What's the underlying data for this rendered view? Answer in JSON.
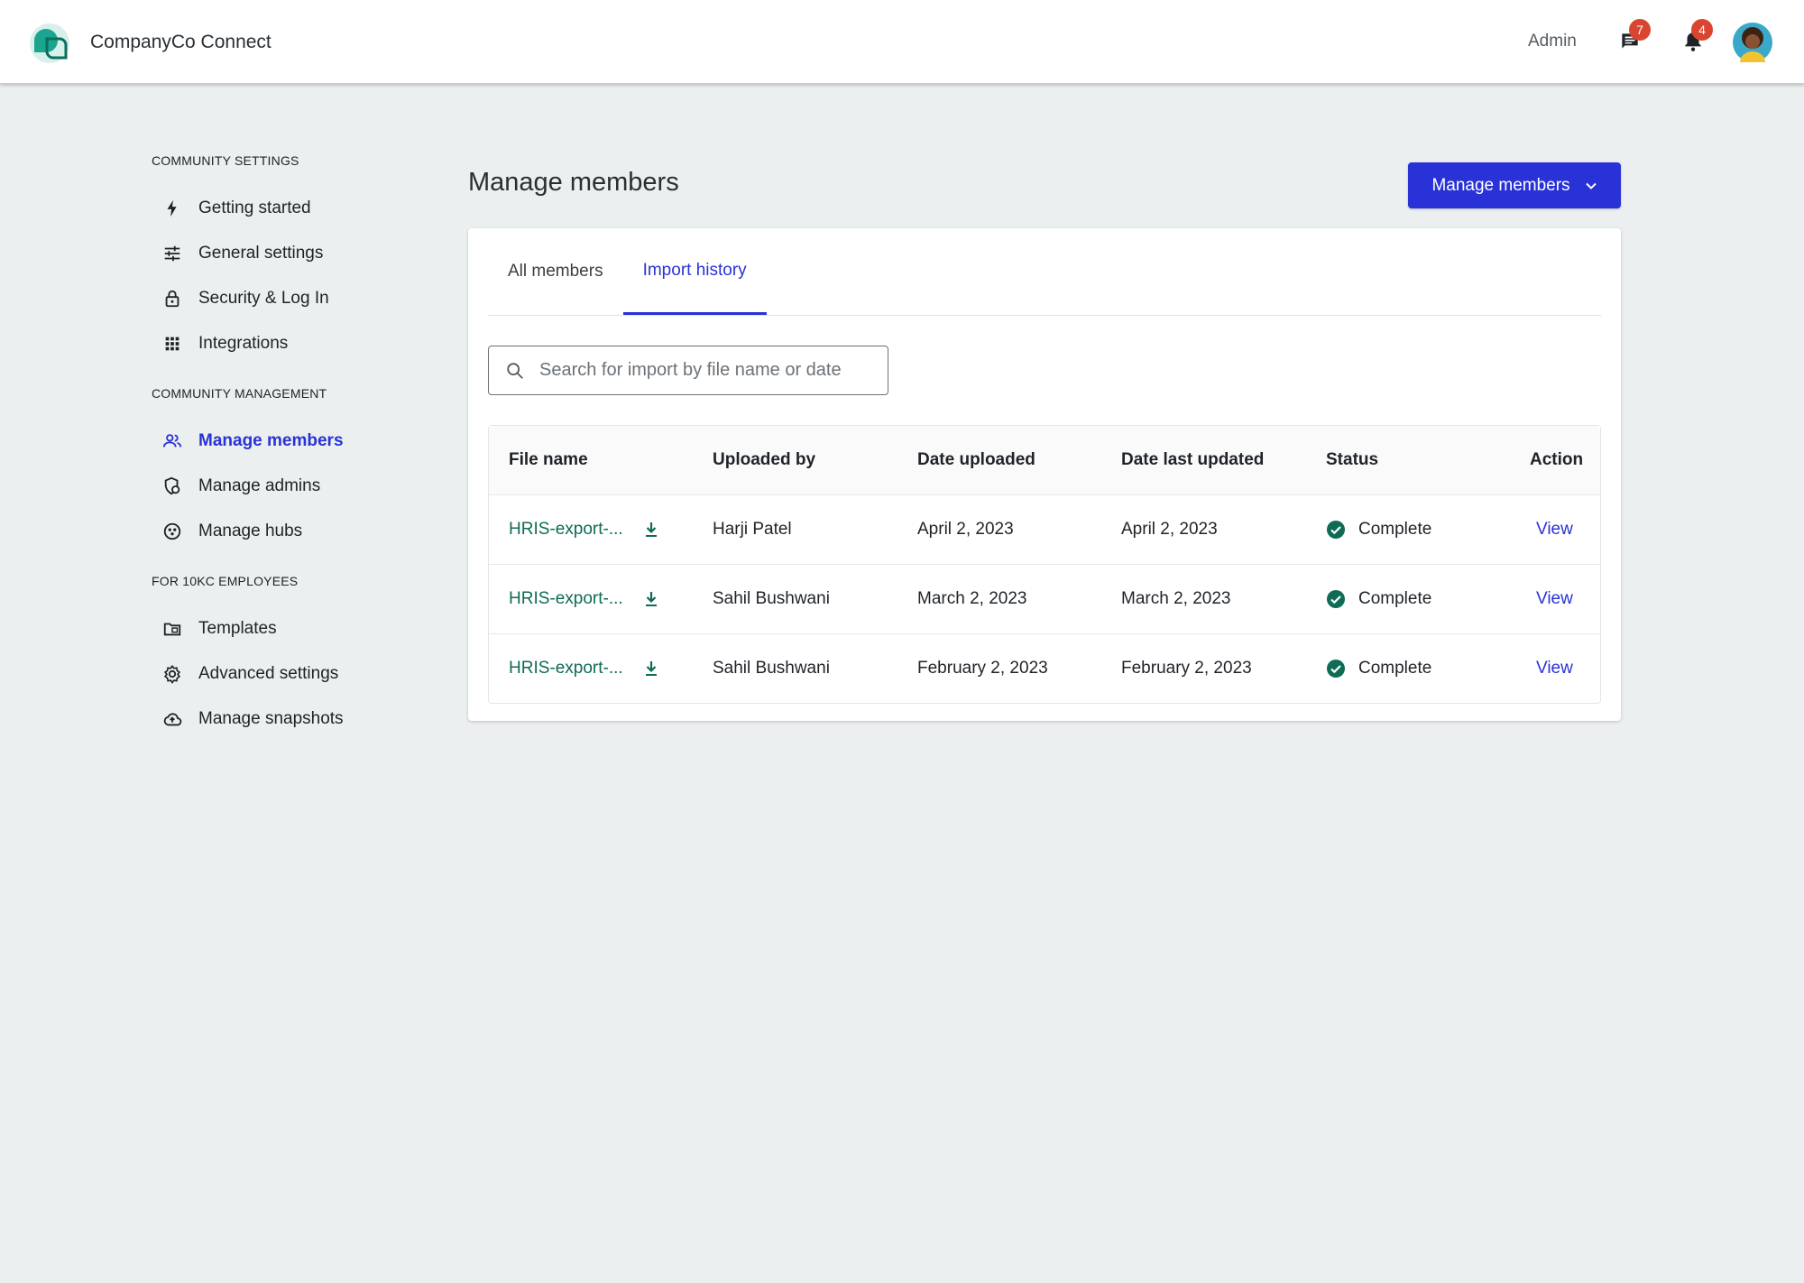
{
  "header": {
    "app_name": "CompanyCo Connect",
    "admin_label": "Admin",
    "messages_count": "7",
    "notifications_count": "4"
  },
  "sidebar": {
    "groups": [
      {
        "heading": "COMMUNITY SETTINGS",
        "items": [
          {
            "label": "Getting started",
            "icon": "bolt-icon"
          },
          {
            "label": "General settings",
            "icon": "sliders-icon"
          },
          {
            "label": "Security & Log In",
            "icon": "lock-icon"
          },
          {
            "label": "Integrations",
            "icon": "grid-icon"
          }
        ]
      },
      {
        "heading": "COMMUNITY MANAGEMENT",
        "items": [
          {
            "label": "Manage members",
            "icon": "people-icon",
            "active": true
          },
          {
            "label": "Manage admins",
            "icon": "admin-shield-icon"
          },
          {
            "label": "Manage hubs",
            "icon": "hub-icon"
          }
        ]
      },
      {
        "heading": "FOR 10KC EMPLOYEES",
        "items": [
          {
            "label": "Templates",
            "icon": "folder-icon"
          },
          {
            "label": "Advanced settings",
            "icon": "gear-icon"
          },
          {
            "label": "Manage snapshots",
            "icon": "cloud-upload-icon"
          }
        ]
      }
    ]
  },
  "main": {
    "title": "Manage members",
    "action_button": "Manage members",
    "tabs": [
      {
        "label": "All members",
        "active": false
      },
      {
        "label": "Import history",
        "active": true
      }
    ],
    "search": {
      "placeholder": "Search for import by file name or date",
      "value": ""
    },
    "table": {
      "columns": [
        "File name",
        "Uploaded by",
        "Date uploaded",
        "Date last updated",
        "Status",
        "Action"
      ],
      "rows": [
        {
          "file": "HRIS-export-...",
          "uploaded_by": "Harji Patel",
          "date_uploaded": "April 2, 2023",
          "date_updated": "April 2, 2023",
          "status": "Complete",
          "action": "View"
        },
        {
          "file": "HRIS-export-...",
          "uploaded_by": "Sahil Bushwani",
          "date_uploaded": "March 2, 2023",
          "date_updated": "March 2, 2023",
          "status": "Complete",
          "action": "View"
        },
        {
          "file": "HRIS-export-...",
          "uploaded_by": "Sahil Bushwani",
          "date_uploaded": "February 2, 2023",
          "date_updated": "February 2, 2023",
          "status": "Complete",
          "action": "View"
        }
      ]
    }
  },
  "colors": {
    "accent": "#2932d6",
    "file_link": "#0e6b55",
    "status_complete": "#0e6b55",
    "badge": "#d9452f",
    "background": "#ecefef"
  }
}
